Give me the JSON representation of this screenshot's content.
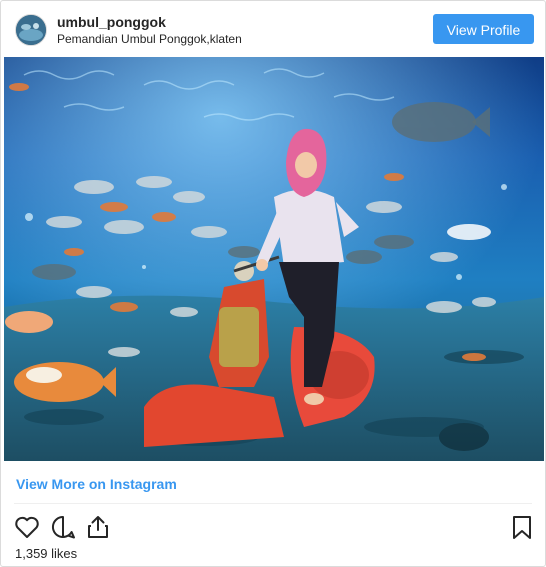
{
  "post": {
    "username": "umbul_ponggok",
    "location": "Pemandian Umbul Ponggok,klaten",
    "view_profile_label": "View Profile",
    "photo_alt": "",
    "more_link": "View More on Instagram",
    "likes": "1,359 likes"
  },
  "icons": {
    "like": "heart-icon",
    "comment": "comment-icon",
    "share": "share-icon",
    "save": "bookmark-icon"
  },
  "colors": {
    "accent": "#3897f0",
    "border": "#dbdbdb",
    "text": "#262626"
  }
}
